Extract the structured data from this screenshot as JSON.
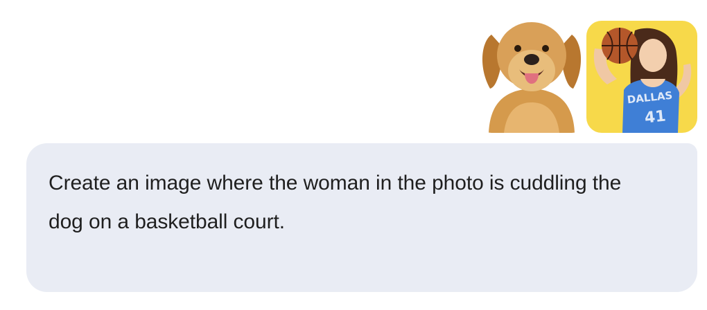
{
  "attachments": [
    {
      "icon": "dog-photo-thumbnail",
      "shows": "golden retriever"
    },
    {
      "icon": "woman-photo-thumbnail",
      "shows": "woman holding basketball",
      "jersey_text": "DALLAS",
      "jersey_number": "41"
    }
  ],
  "message": {
    "text": "Create an image where the woman in the photo is cuddling the dog on a basketball court."
  },
  "colors": {
    "bubble_background": "#e9ecf4",
    "text": "#1f1f1f",
    "woman_photo_background": "#f7d94a",
    "jersey": "#3f7fd6"
  }
}
